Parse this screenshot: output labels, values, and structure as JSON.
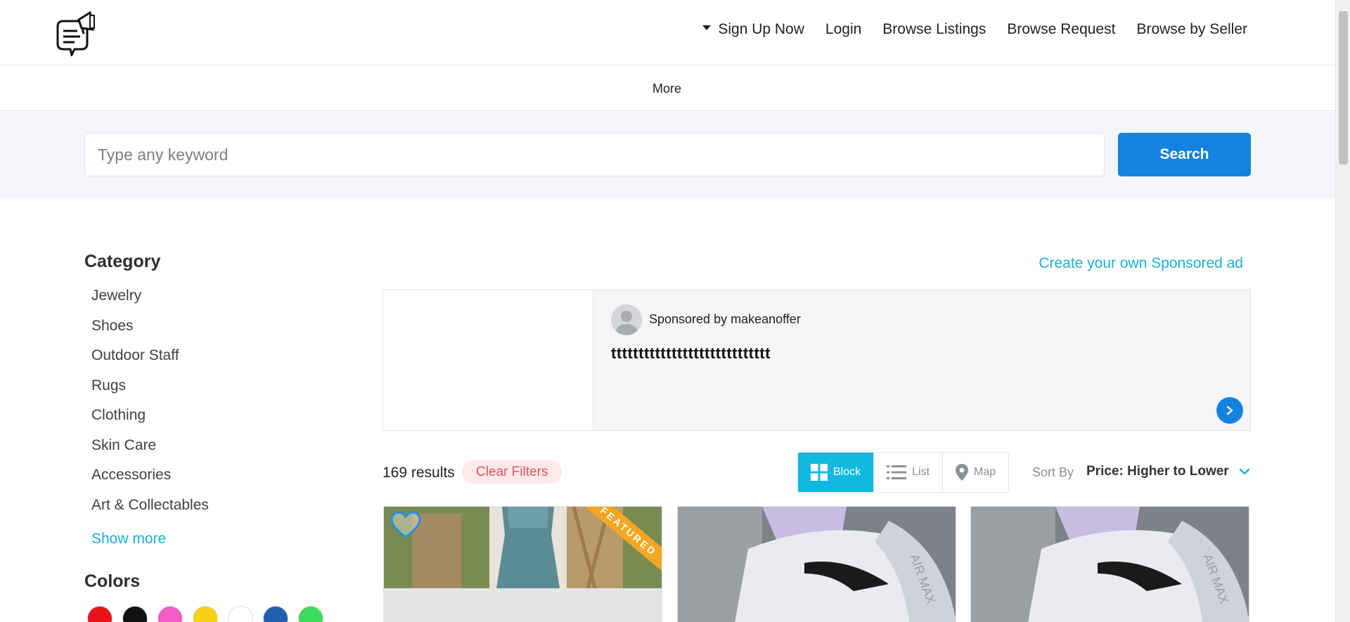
{
  "header": {
    "nav": [
      {
        "label": "Sign Up Now",
        "has_caret": true
      },
      {
        "label": "Login"
      },
      {
        "label": "Browse Listings"
      },
      {
        "label": "Browse Request"
      },
      {
        "label": "Browse by Seller"
      }
    ],
    "more_label": "More"
  },
  "search": {
    "placeholder": "Type any keyword",
    "button_label": "Search"
  },
  "sidebar": {
    "category_title": "Category",
    "categories": [
      "Jewelry",
      "Shoes",
      "Outdoor Staff",
      "Rugs",
      "Clothing",
      "Skin Care",
      "Accessories",
      "Art & Collectables"
    ],
    "show_more": "Show more",
    "colors_title": "Colors",
    "colors": [
      "#e8141a",
      "#111111",
      "#f25ccb",
      "#f7d117",
      "#ffffff",
      "#1f5fae",
      "#3ddc5e"
    ]
  },
  "sponsor": {
    "create_link": "Create your own Sponsored ad",
    "by_label": "Sponsored by makeanoffer",
    "title": "ttttttttttttttttttttttttttttt"
  },
  "results": {
    "count_label": "169 results",
    "clear_filters": "Clear Filters",
    "views": [
      "Block",
      "List",
      "Map"
    ],
    "active_view": "Block",
    "sort_label": "Sort By",
    "sort_value": "Price: Higher to Lower"
  },
  "cards": [
    {
      "featured_label": "FEATURED"
    },
    {},
    {}
  ],
  "colors": {
    "primary": "#1482e0",
    "accent_cyan": "#11b8e0",
    "featured": "#f5a623"
  }
}
